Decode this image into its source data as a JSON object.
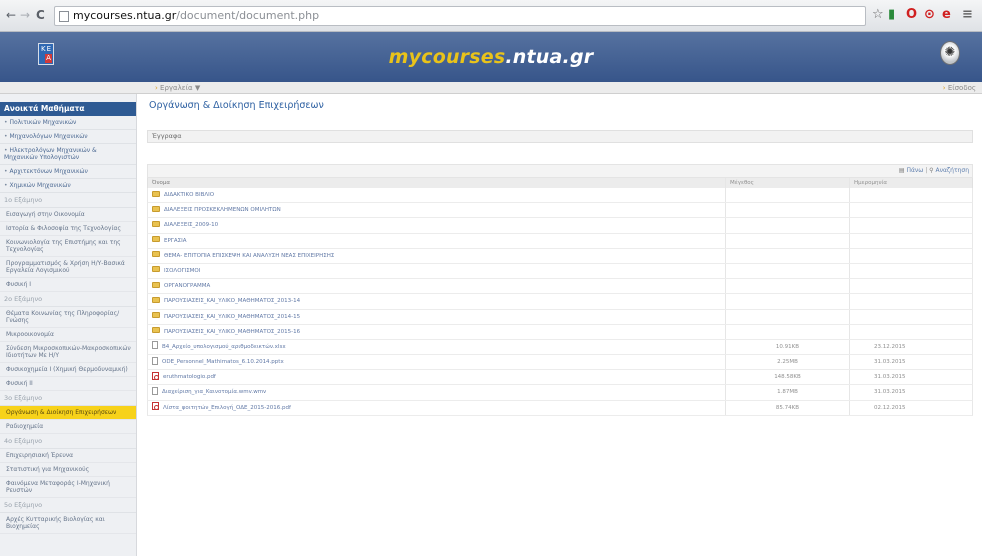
{
  "browser": {
    "url_host": "mycourses.ntua.gr",
    "url_path": "/document/document.php",
    "back_glyph": "←",
    "forward_glyph": "→",
    "reload_glyph": "C",
    "star_glyph": "☆",
    "ext_glyphs": [
      "▮",
      "O",
      "⊙",
      "e",
      "≡"
    ]
  },
  "header": {
    "logo_k": "K",
    "logo_e": "E",
    "logo_a": "A",
    "site_title_main": "mycourses",
    "site_title_domain": ".ntua.gr",
    "emblem_glyph": "✺"
  },
  "subbar": {
    "tools_label": "Εργαλεία",
    "tools_caret": "▼",
    "login_label": "Είσοδος"
  },
  "sidebar": {
    "heading": "Ανοικτά Μαθήματα",
    "links": [
      "Πολιτικών Μηχανικών",
      "Μηχανολόγων Μηχανικών",
      "Ηλεκτρολόγων Μηχανικών & Μηχανικών Υπολογιστών",
      "Αρχιτεκτόνων Μηχανικών",
      "Χημικών Μηχανικών"
    ],
    "sections": [
      {
        "label": "1ο Εξάμηνο",
        "courses": [
          "Εισαγωγή στην Οικονομία",
          "Ιστορία & Φιλοσοφία της Τεχνολογίας",
          "Κοινωνιολογία της Επιστήμης και της Τεχνολογίας",
          "Προγραμματισμός & Χρήση Η/Υ-Βασικά Εργαλεία Λογισμικού",
          "Φυσική Ι"
        ]
      },
      {
        "label": "2ο Εξάμηνο",
        "courses": [
          "Θέματα Κοινωνίας της Πληροφορίας/Γνώσης",
          "Μικροοικονομία",
          "Σύνδεση Μικροσκοπικών-Μακροσκοπικών Ιδιοτήτων Με Η/Υ",
          "Φυσικοχημεία Ι (Χημική Θερμοδυναμική)",
          "Φυσική ΙΙ"
        ]
      },
      {
        "label": "3ο Εξάμηνο",
        "courses": [
          "Οργάνωση & Διοίκηση Επιχειρήσεων",
          "Ραδιοχημεία"
        ]
      },
      {
        "label": "4ο Εξάμηνο",
        "courses": [
          "Επιχειρησιακή Έρευνα",
          "Στατιστική για Μηχανικούς",
          "Φαινόμενα Μεταφοράς Ι-Μηχανική Ρευστών"
        ]
      },
      {
        "label": "5ο Εξάμηνο",
        "courses": [
          "Αρχές Κυτταρικής Βιολογίας και Βιοχημείας"
        ]
      }
    ],
    "active_course": "Οργάνωση & Διοίκηση Επιχειρήσεων"
  },
  "main": {
    "page_title": "Οργάνωση & Διοίκηση Επιχειρήσεων",
    "doc_heading": "Έγγραφα",
    "actions": {
      "up_label": "Πάνω",
      "search_label": "Αναζήτηση",
      "separator": "|"
    },
    "columns": [
      "Όνομα",
      "Μέγεθος",
      "Ημερομηνία"
    ],
    "rows": [
      {
        "type": "folder",
        "name": "ΔΙΔΑΚΤΙΚΟ ΒΙΒΛΙΟ",
        "size": "",
        "date": ""
      },
      {
        "type": "folder",
        "name": "ΔΙΑΛΕΞΕΙΣ ΠΡΟΣΚΕΚΛΗΜΕΝΩΝ ΟΜΙΛΗΤΩΝ",
        "size": "",
        "date": ""
      },
      {
        "type": "folder",
        "name": "ΔΙΑΛΕΞΕΙΣ_2009-10",
        "size": "",
        "date": ""
      },
      {
        "type": "folder",
        "name": "ΕΡΓΑΣΙΑ",
        "size": "",
        "date": ""
      },
      {
        "type": "folder",
        "name": "ΘΕΜΑ- ΕΠΙΤΟΠΙΑ ΕΠΙΣΚΕΨΗ ΚΑΙ ΑΝΑΛΥΣΗ ΝΕΑΣ ΕΠΙΧΕΙΡΗΣΗΣ",
        "size": "",
        "date": ""
      },
      {
        "type": "folder",
        "name": "ΙΣΟΛΟΓΙΣΜΟΙ",
        "size": "",
        "date": ""
      },
      {
        "type": "folder",
        "name": "ΟΡΓΑΝΟΓΡΑΜΜΑ",
        "size": "",
        "date": ""
      },
      {
        "type": "folder",
        "name": "ΠΑΡΟΥΣΙΑΣΕΙΣ_ΚΑΙ_ΥΛΙΚΟ_ΜΑΘΗΜΑΤΟΣ_2013-14",
        "size": "",
        "date": ""
      },
      {
        "type": "folder",
        "name": "ΠΑΡΟΥΣΙΑΣΕΙΣ_ΚΑΙ_ΥΛΙΚΟ_ΜΑΘΗΜΑΤΟΣ_2014-15",
        "size": "",
        "date": ""
      },
      {
        "type": "folder",
        "name": "ΠΑΡΟΥΣΙΑΣΕΙΣ_ΚΑΙ_ΥΛΙΚΟ_ΜΑΘΗΜΑΤΟΣ_2015-16",
        "size": "",
        "date": ""
      },
      {
        "type": "doc",
        "name": "B4_Αρχείο_υπολογισμού_αριθμοδεικτών.xlsx",
        "size": "10.91KB",
        "date": "23.12.2015"
      },
      {
        "type": "doc",
        "name": "ODE_Personnel_Mathimatos_6.10.2014.pptx",
        "size": "2.25MB",
        "date": "31.03.2015"
      },
      {
        "type": "pdf",
        "name": "eruthmatologio.pdf",
        "size": "148.58KB",
        "date": "31.03.2015"
      },
      {
        "type": "doc",
        "name": "Διαχείριση_για_Καινοτομία.wmv.wmv",
        "size": "1.87MB",
        "date": "31.03.2015"
      },
      {
        "type": "pdf",
        "name": "Λίστα_φοιτητών_Επιλογή_ΟΔΕ_2015-2016.pdf",
        "size": "85.74KB",
        "date": "02.12.2015"
      }
    ]
  },
  "colors": {
    "header_bg": "#3f5d90",
    "title_accent": "#e9c31a",
    "sidebar_heading_bg": "#2e5a93",
    "active_course_bg": "#f7d21a",
    "page_title": "#2c5fa1"
  }
}
